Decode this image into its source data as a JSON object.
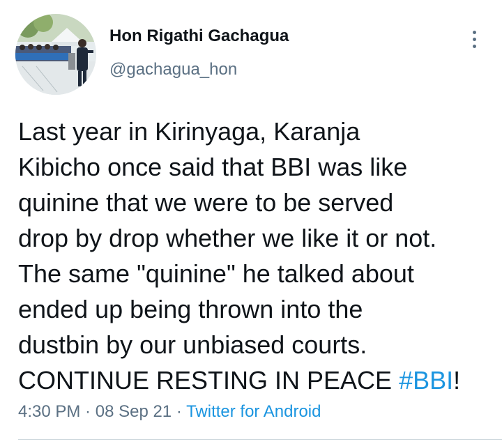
{
  "author": {
    "display_name": "Hon Rigathi Gachagua",
    "handle": "@gachagua_hon",
    "avatar_icon": "profile-photo"
  },
  "menu_icon": "more-vertical-icon",
  "tweet": {
    "lines": [
      "Last year in Kirinyaga, Karanja",
      "Kibicho once said that BBI was like",
      "quinine that we were to be served",
      "drop by drop whether we like it or not.",
      "The same \"quinine\" he talked about",
      "ended up being thrown into the",
      "dustbin by our unbiased courts."
    ],
    "last_line_text": "CONTINUE RESTING IN PEACE ",
    "hashtag": "#BBI",
    "last_line_end": "!"
  },
  "meta": {
    "time": "4:30 PM",
    "separator": " · ",
    "date": "08 Sep 21",
    "source": "Twitter for Android"
  },
  "colors": {
    "link": "#1b95e0",
    "secondary_text": "#5b7083",
    "primary_text": "#0f1419"
  }
}
